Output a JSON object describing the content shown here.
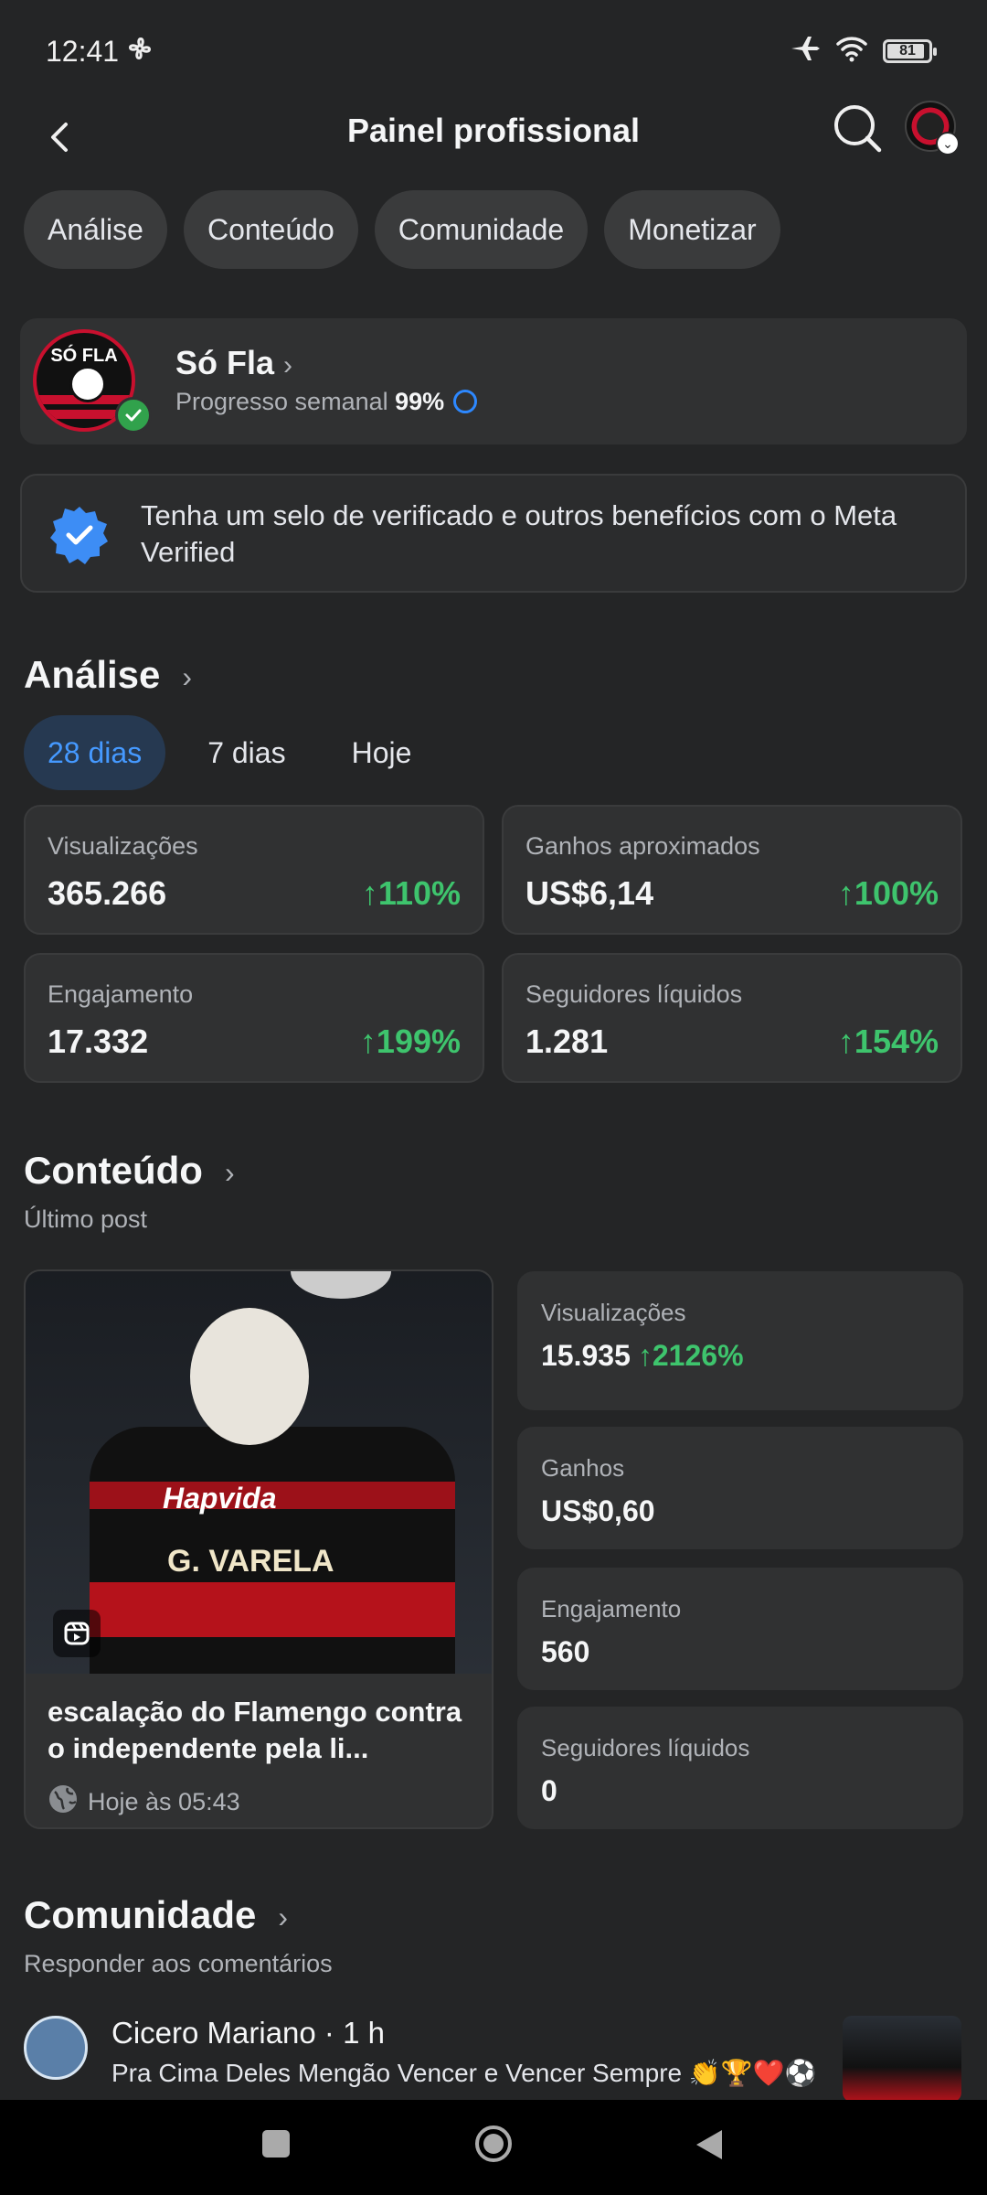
{
  "status_bar": {
    "time": "12:41",
    "battery": "81"
  },
  "header": {
    "title": "Painel profissional"
  },
  "chips": [
    "Análise",
    "Conteúdo",
    "Comunidade",
    "Monetizar"
  ],
  "profile": {
    "name": "Só Fla",
    "progress_label": "Progresso semanal",
    "progress_value": "99%",
    "logo_text": "SÓ FLA"
  },
  "meta_verified": {
    "text": "Tenha um selo de verificado e outros benefícios com o Meta Verified"
  },
  "analysis": {
    "title": "Análise",
    "periods": [
      "28 dias",
      "7 dias",
      "Hoje"
    ],
    "active_period": "28 dias",
    "metrics": [
      {
        "label": "Visualizações",
        "value": "365.266",
        "change": "110%"
      },
      {
        "label": "Ganhos aproximados",
        "value": "US$6,14",
        "change": "100%"
      },
      {
        "label": "Engajamento",
        "value": "17.332",
        "change": "199%"
      },
      {
        "label": "Seguidores líquidos",
        "value": "1.281",
        "change": "154%"
      }
    ]
  },
  "content": {
    "title": "Conteúdo",
    "subtitle": "Último post",
    "post": {
      "title": "escalação do Flamengo contra o independente pela li...",
      "date": "Hoje às 05:43",
      "image_sponsor": "Hapvida",
      "image_name": "G. VARELA"
    },
    "stats": [
      {
        "label": "Visualizações",
        "value": "15.935",
        "change": "2126%"
      },
      {
        "label": "Ganhos",
        "value": "US$0,60"
      },
      {
        "label": "Engajamento",
        "value": "560"
      },
      {
        "label": "Seguidores líquidos",
        "value": "0"
      }
    ]
  },
  "community": {
    "title": "Comunidade",
    "subtitle": "Responder aos comentários",
    "comment": {
      "author": "Cicero Mariano · 1 h",
      "text": "Pra Cima Deles Mengão Vencer e Vencer Sempre 👏🏆❤️⚽"
    }
  },
  "colors": {
    "background": "#242526",
    "card": "#303132",
    "accent_blue": "#4599ff",
    "positive_green": "#3ec46d"
  }
}
